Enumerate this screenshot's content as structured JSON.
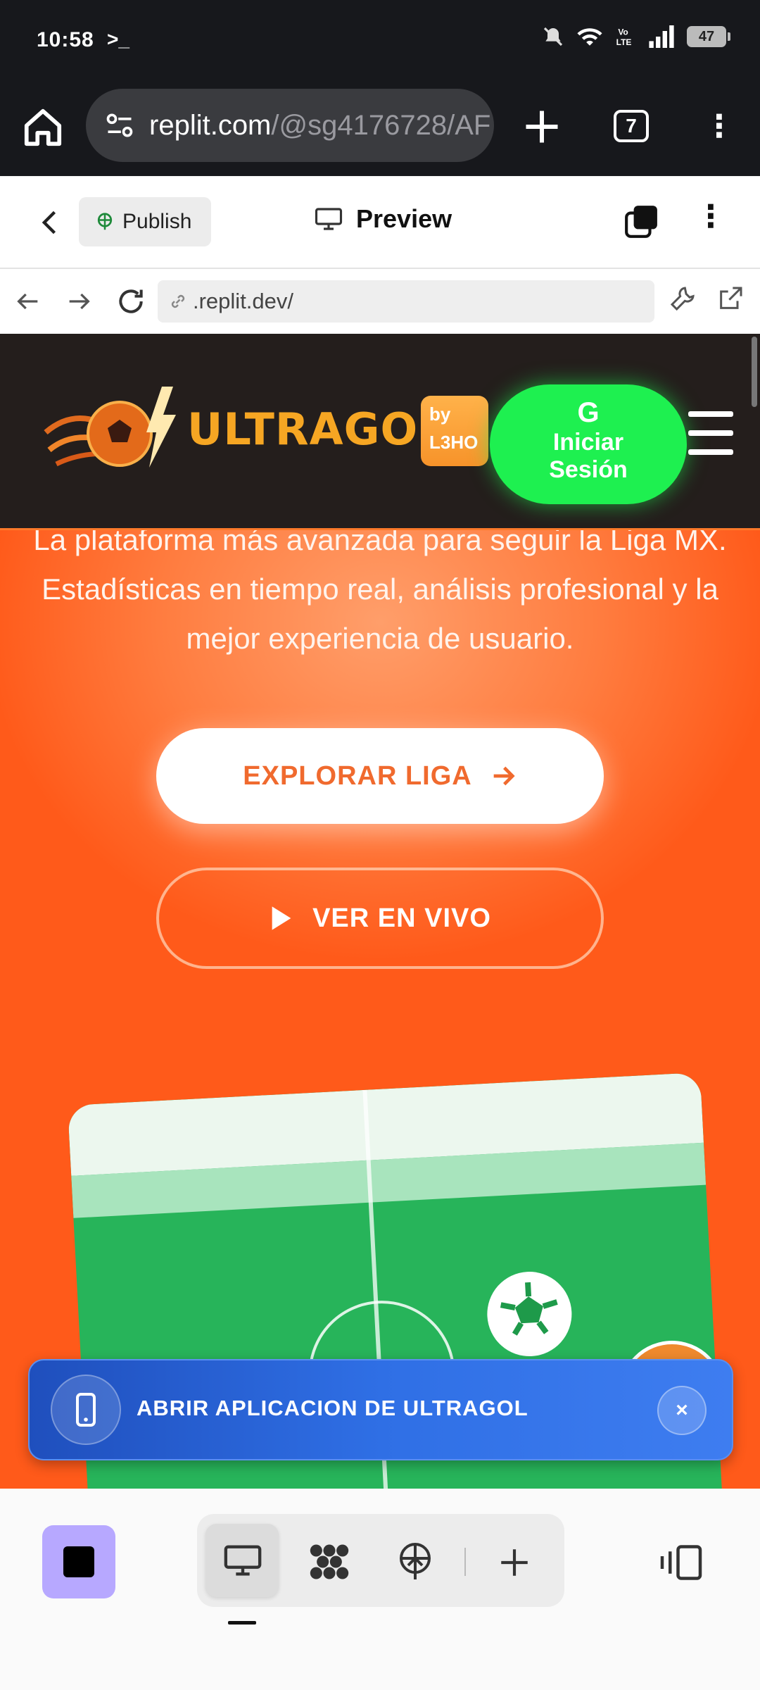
{
  "status_bar": {
    "time": "10:58",
    "prompt": ">_",
    "battery": "47"
  },
  "browser": {
    "url_host": "replit.com",
    "url_path": "/@sg4176728/AF",
    "tab_count": "7"
  },
  "replit": {
    "publish_label": "Publish",
    "preview_label": "Preview"
  },
  "webview": {
    "address": ".replit.dev/"
  },
  "site": {
    "logo_text": "ULTRAGOL",
    "by_badge_line1": "by",
    "by_badge_line2": "L3HO",
    "login_icon": "G",
    "login_line1": "Iniciar",
    "login_line2": "Sesión",
    "description": "La plataforma más avanzada para seguir la Liga MX. Estadísticas en tiempo real, análisis profesional y la mejor experiencia de usuario.",
    "explore_label": "EXPLORAR LIGA",
    "live_label": "VER EN VIVO"
  },
  "banner": {
    "text": "ABRIR APLICACION DE ULTRAGOL",
    "close": "×"
  },
  "colors": {
    "accent_orange": "#ff6a2a",
    "login_green": "#1ef050",
    "banner_blue": "#2f6fe5",
    "stop_purple": "#b7a8ff"
  },
  "icons": [
    "home-icon",
    "site-settings-icon",
    "plus-icon",
    "tabs-icon",
    "menu-icon",
    "back-icon",
    "publish-icon",
    "monitor-icon",
    "layers-icon",
    "nav-back-icon",
    "nav-forward-icon",
    "reload-icon",
    "link-icon",
    "wrench-icon",
    "external-link-icon",
    "logo-ball-icon",
    "hamburger-icon",
    "arrow-right-icon",
    "play-icon",
    "phone-icon",
    "close-icon",
    "stop-icon",
    "preview-icon",
    "dots-cluster-icon",
    "deploy-icon",
    "add-tool-icon",
    "split-view-icon"
  ]
}
